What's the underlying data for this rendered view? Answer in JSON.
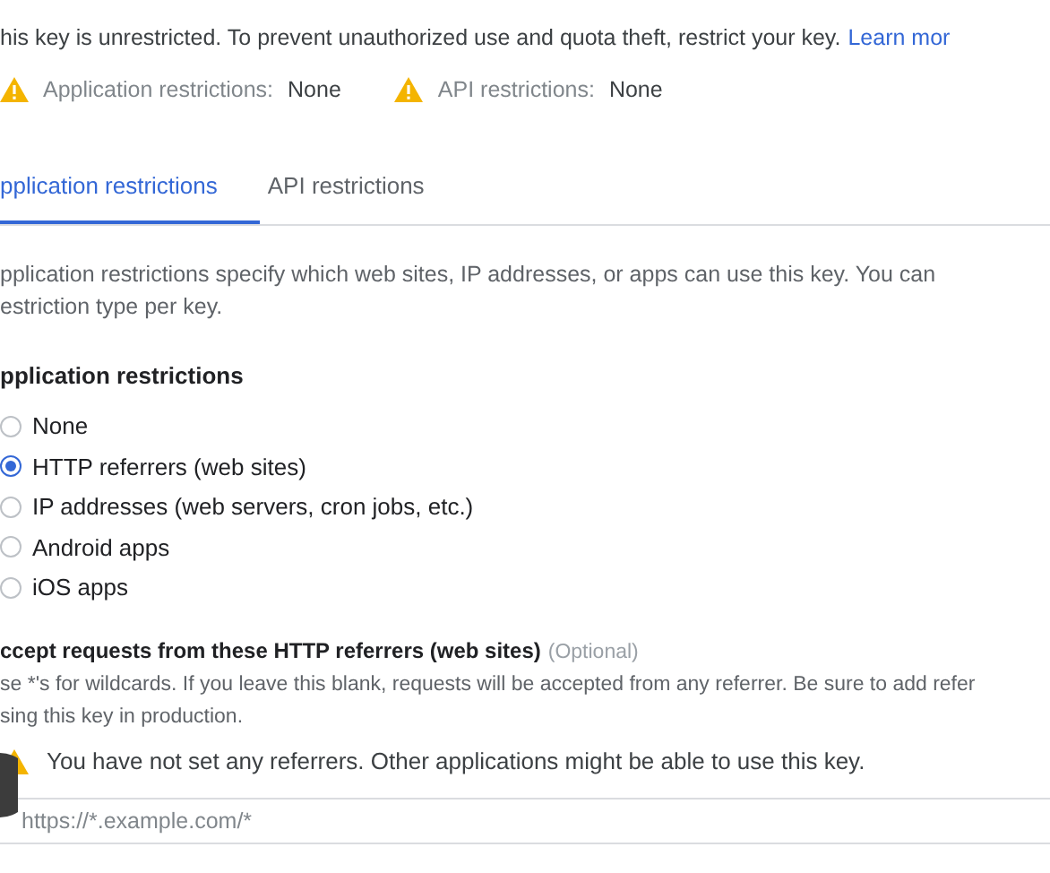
{
  "notice": {
    "text": "his key is unrestricted. To prevent unauthorized use and quota theft, restrict your key.",
    "link": "Learn mor"
  },
  "summary": [
    {
      "label": "Application restrictions:",
      "value": "None",
      "warning": true
    },
    {
      "label": "API restrictions:",
      "value": "None",
      "warning": true
    }
  ],
  "tabs": [
    {
      "label": "pplication restrictions",
      "selected": true
    },
    {
      "label": "API restrictions",
      "selected": false
    }
  ],
  "description": [
    "pplication restrictions specify which web sites, IP addresses, or apps can use this key. You can",
    "estriction type per key."
  ],
  "restrictions": {
    "heading": "pplication restrictions",
    "options": [
      {
        "label": "None",
        "selected": false
      },
      {
        "label": "HTTP referrers (web sites)",
        "selected": true
      },
      {
        "label": "IP addresses (web servers, cron jobs, etc.)",
        "selected": false
      },
      {
        "label": "Android apps",
        "selected": false
      },
      {
        "label": "iOS apps",
        "selected": false
      }
    ]
  },
  "referrers": {
    "heading": "ccept requests from these HTTP referrers (web sites)",
    "optional": "(Optional)",
    "help": [
      "se *'s for wildcards. If you leave this blank, requests will be accepted from any referrer. Be sure to add refer",
      "sing this key in production."
    ],
    "warning": "You have not set any referrers. Other applications might be able to use this key.",
    "placeholder": "https://*.example.com/*"
  }
}
